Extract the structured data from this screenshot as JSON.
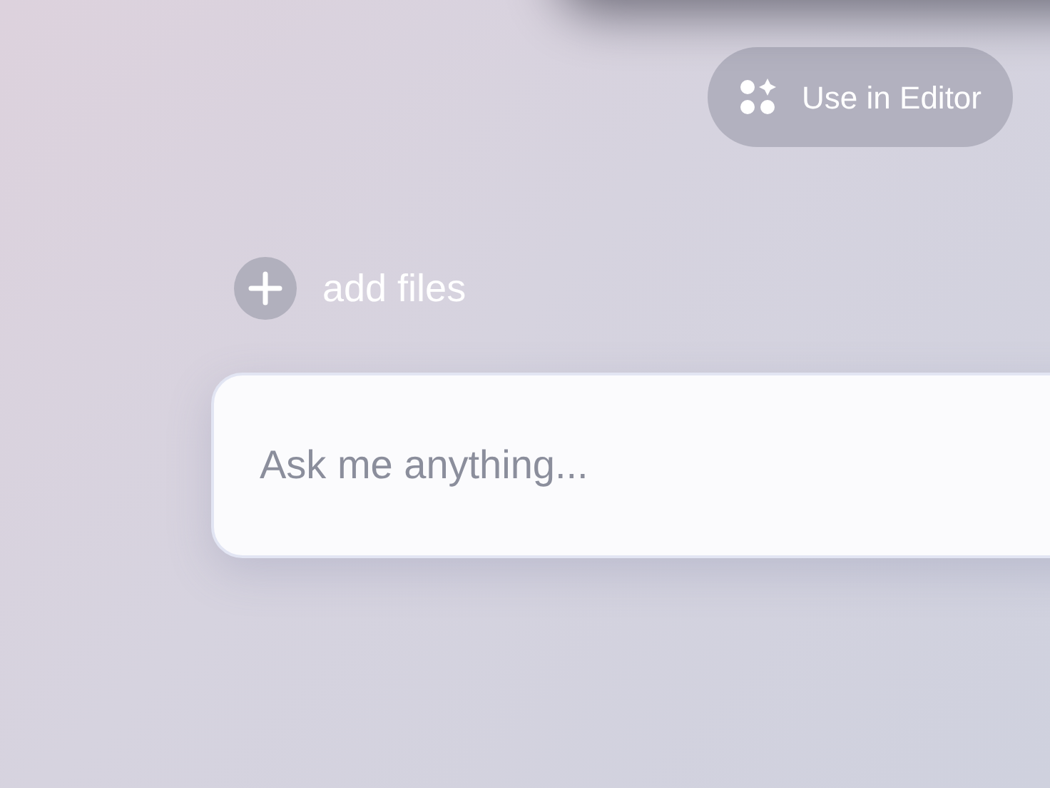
{
  "editor_button": {
    "label": "Use in Editor"
  },
  "add_files": {
    "label": "add files"
  },
  "prompt": {
    "placeholder": "Ask me anything..."
  }
}
